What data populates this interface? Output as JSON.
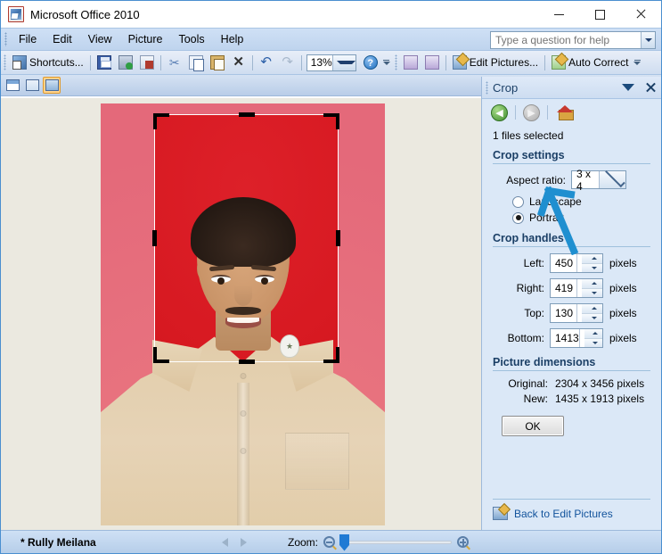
{
  "window": {
    "title": "Microsoft Office 2010",
    "icon": "picture-manager-icon",
    "minimize": "–",
    "maximize": "□",
    "close": "×"
  },
  "menubar": {
    "items": [
      {
        "label": "File"
      },
      {
        "label": "Edit"
      },
      {
        "label": "View"
      },
      {
        "label": "Picture"
      },
      {
        "label": "Tools"
      },
      {
        "label": "Help"
      }
    ],
    "help_box": {
      "placeholder": "Type a question for help",
      "value": ""
    }
  },
  "toolbar": {
    "shortcuts_label": "Shortcuts...",
    "zoom_value": "13%",
    "edit_pictures_label": "Edit Pictures...",
    "auto_correct_label": "Auto Correct",
    "help_glyph": "?",
    "icons": [
      "shortcuts-icon",
      "save-icon",
      "save-as-icon",
      "send-mail-icon",
      "cut-icon",
      "copy-icon",
      "paste-icon",
      "delete-icon",
      "undo-icon",
      "redo-icon",
      "rotate-left-icon",
      "rotate-right-icon"
    ]
  },
  "viewbar": {
    "buttons": [
      {
        "name": "thumbnail-view",
        "active": false
      },
      {
        "name": "filmstrip-view",
        "active": false
      },
      {
        "name": "single-picture-view",
        "active": true
      }
    ]
  },
  "pane": {
    "title": "Crop",
    "nav": {
      "back": "back-icon",
      "forward": "forward-icon",
      "home": "home-icon"
    },
    "files_selected": "1 files selected",
    "crop_settings": {
      "section_title": "Crop settings",
      "aspect_ratio_label": "Aspect ratio:",
      "aspect_ratio_value": "3 x 4",
      "orientation": [
        {
          "label": "Landscape",
          "selected": false
        },
        {
          "label": "Portrait",
          "selected": true
        }
      ]
    },
    "crop_handles": {
      "section_title": "Crop handles",
      "unit": "pixels",
      "fields": [
        {
          "label": "Left:",
          "value": "450"
        },
        {
          "label": "Right:",
          "value": "419"
        },
        {
          "label": "Top:",
          "value": "130"
        },
        {
          "label": "Bottom:",
          "value": "1413"
        }
      ]
    },
    "picture_dimensions": {
      "section_title": "Picture dimensions",
      "rows": [
        {
          "label": "Original:",
          "value": "2304 x 3456 pixels"
        },
        {
          "label": "New:",
          "value": "1435 x 1913 pixels"
        }
      ]
    },
    "ok_label": "OK",
    "footer_link": "Back to Edit Pictures",
    "annotation": {
      "type": "arrow",
      "color": "#1f8fd0",
      "points_to": "ok-button"
    }
  },
  "statusbar": {
    "file_name": "* Rully Meilana",
    "zoom_label": "Zoom:",
    "zoom_out_icon": "zoom-out-icon",
    "zoom_in_icon": "zoom-in-icon",
    "slider_position_percent": 4
  },
  "canvas": {
    "image_name": "portrait-photo",
    "crop_overlay": "crop-selection-handles"
  },
  "colors": {
    "accent": "#1f7ad4",
    "pane_bg": "#dbe8f7",
    "workspace_bg": "#ebe9e0",
    "annotation": "#1f8fd0",
    "photo_background": "#d71921"
  }
}
